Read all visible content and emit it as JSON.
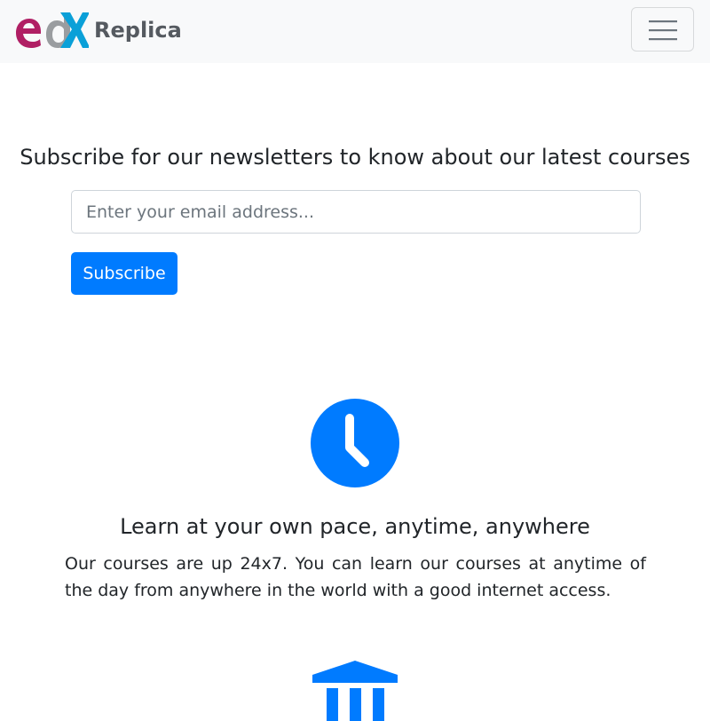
{
  "navbar": {
    "brand_text": "Replica",
    "logo_label": "edX",
    "toggler_icon": "hamburger-menu-icon"
  },
  "newsletter": {
    "title": "Subscribe for our newsletters to know about our latest courses",
    "email_placeholder": "Enter your email address...",
    "email_value": "",
    "button_label": "Subscribe"
  },
  "features": [
    {
      "icon": "clock-icon",
      "title": "Learn at your own pace, anytime, anywhere",
      "description": "Our courses are up 24x7. You can learn our courses at anytime of the day from anywhere in the world with a good internet access."
    },
    {
      "icon": "university-building-icon"
    }
  ],
  "colors": {
    "primary": "#007bff",
    "navbar_bg": "#f8f9fa",
    "logo_e": "#b01f64",
    "logo_d": "#8a8d8f",
    "logo_x": "#0aa0d8"
  }
}
